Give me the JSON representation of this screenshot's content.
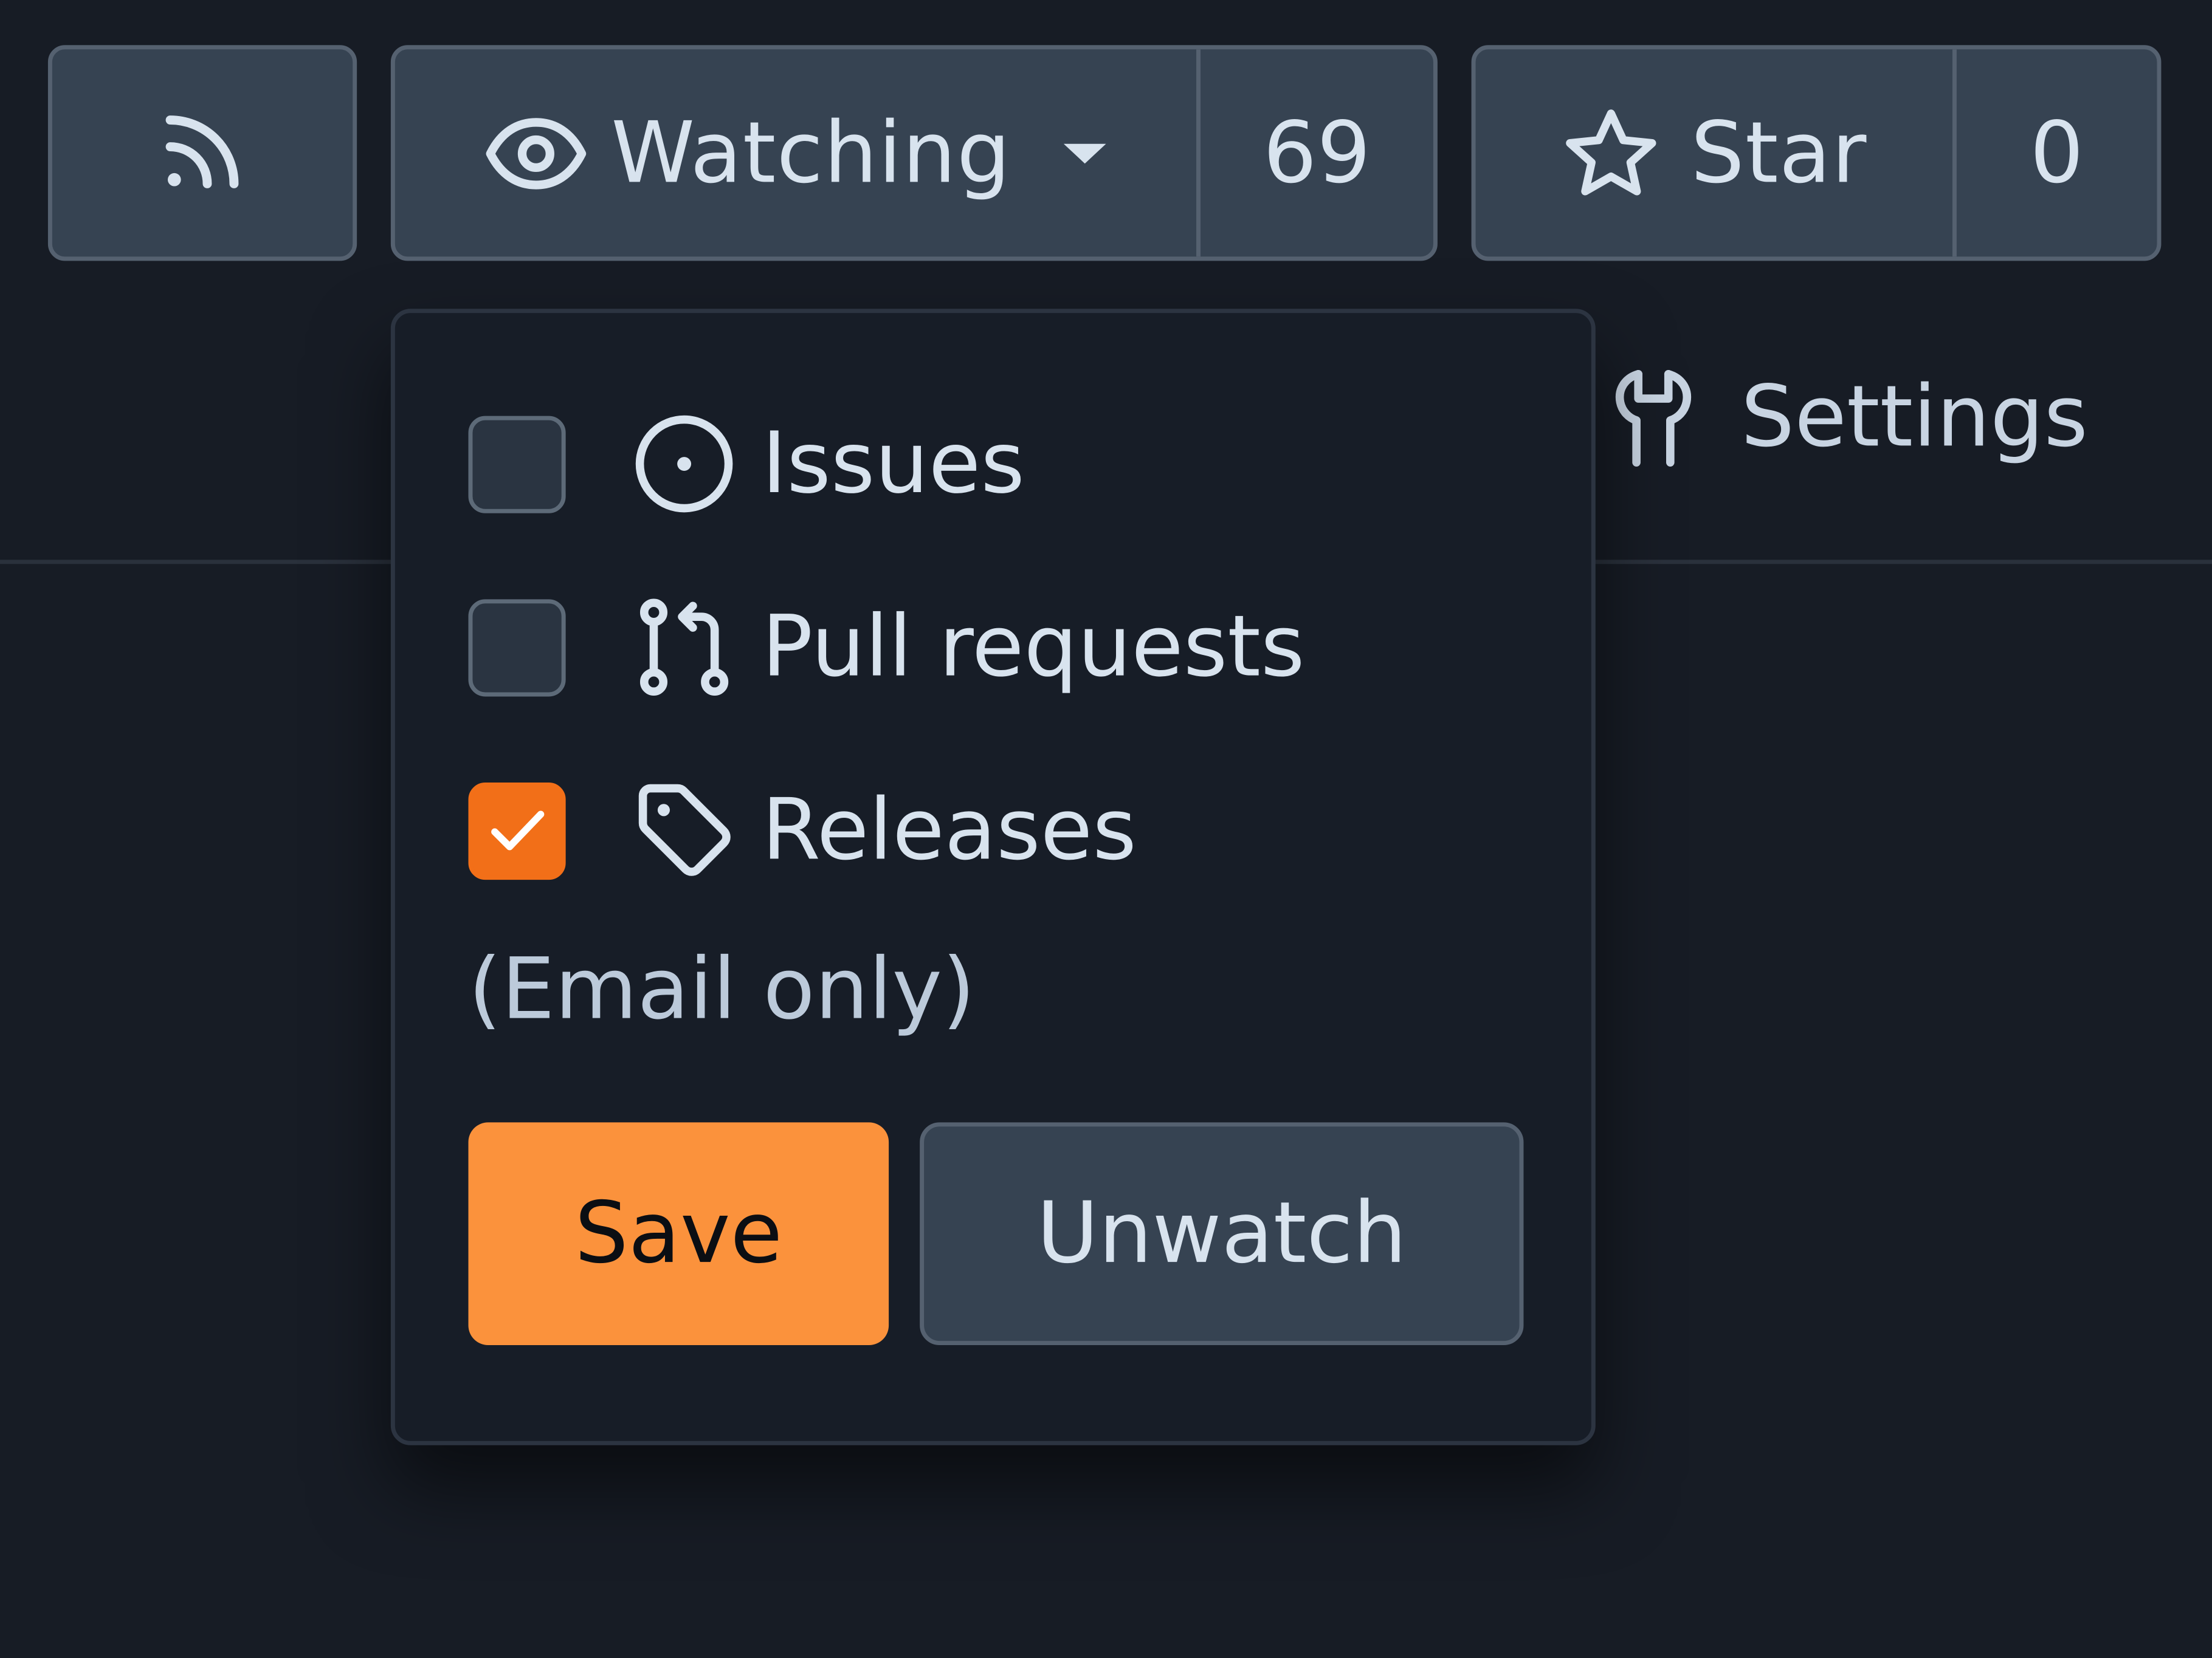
{
  "toolbar": {
    "rss_icon": "rss-icon",
    "watch": {
      "icon": "eye-icon",
      "label": "Watching",
      "dropdown_icon": "caret-down-icon",
      "count": "69"
    },
    "star": {
      "icon": "star-icon",
      "label": "Star",
      "count": "0"
    }
  },
  "nav": {
    "settings": {
      "icon": "wrench-icon",
      "label": "Settings"
    }
  },
  "watch_popover": {
    "options": [
      {
        "label": "Issues",
        "icon": "issue-opened-icon",
        "checked": false
      },
      {
        "label": "Pull requests",
        "icon": "git-pull-request-icon",
        "checked": false
      },
      {
        "label": "Releases",
        "icon": "tag-icon",
        "checked": true
      }
    ],
    "note": "(Email only)",
    "save_label": "Save",
    "unwatch_label": "Unwatch"
  },
  "colors": {
    "background": "#171c25",
    "button_bg": "#364352",
    "button_border": "#556170",
    "accent_checked": "#f26f18",
    "save_bg": "#fb923c",
    "text": "#d8e3ee"
  }
}
